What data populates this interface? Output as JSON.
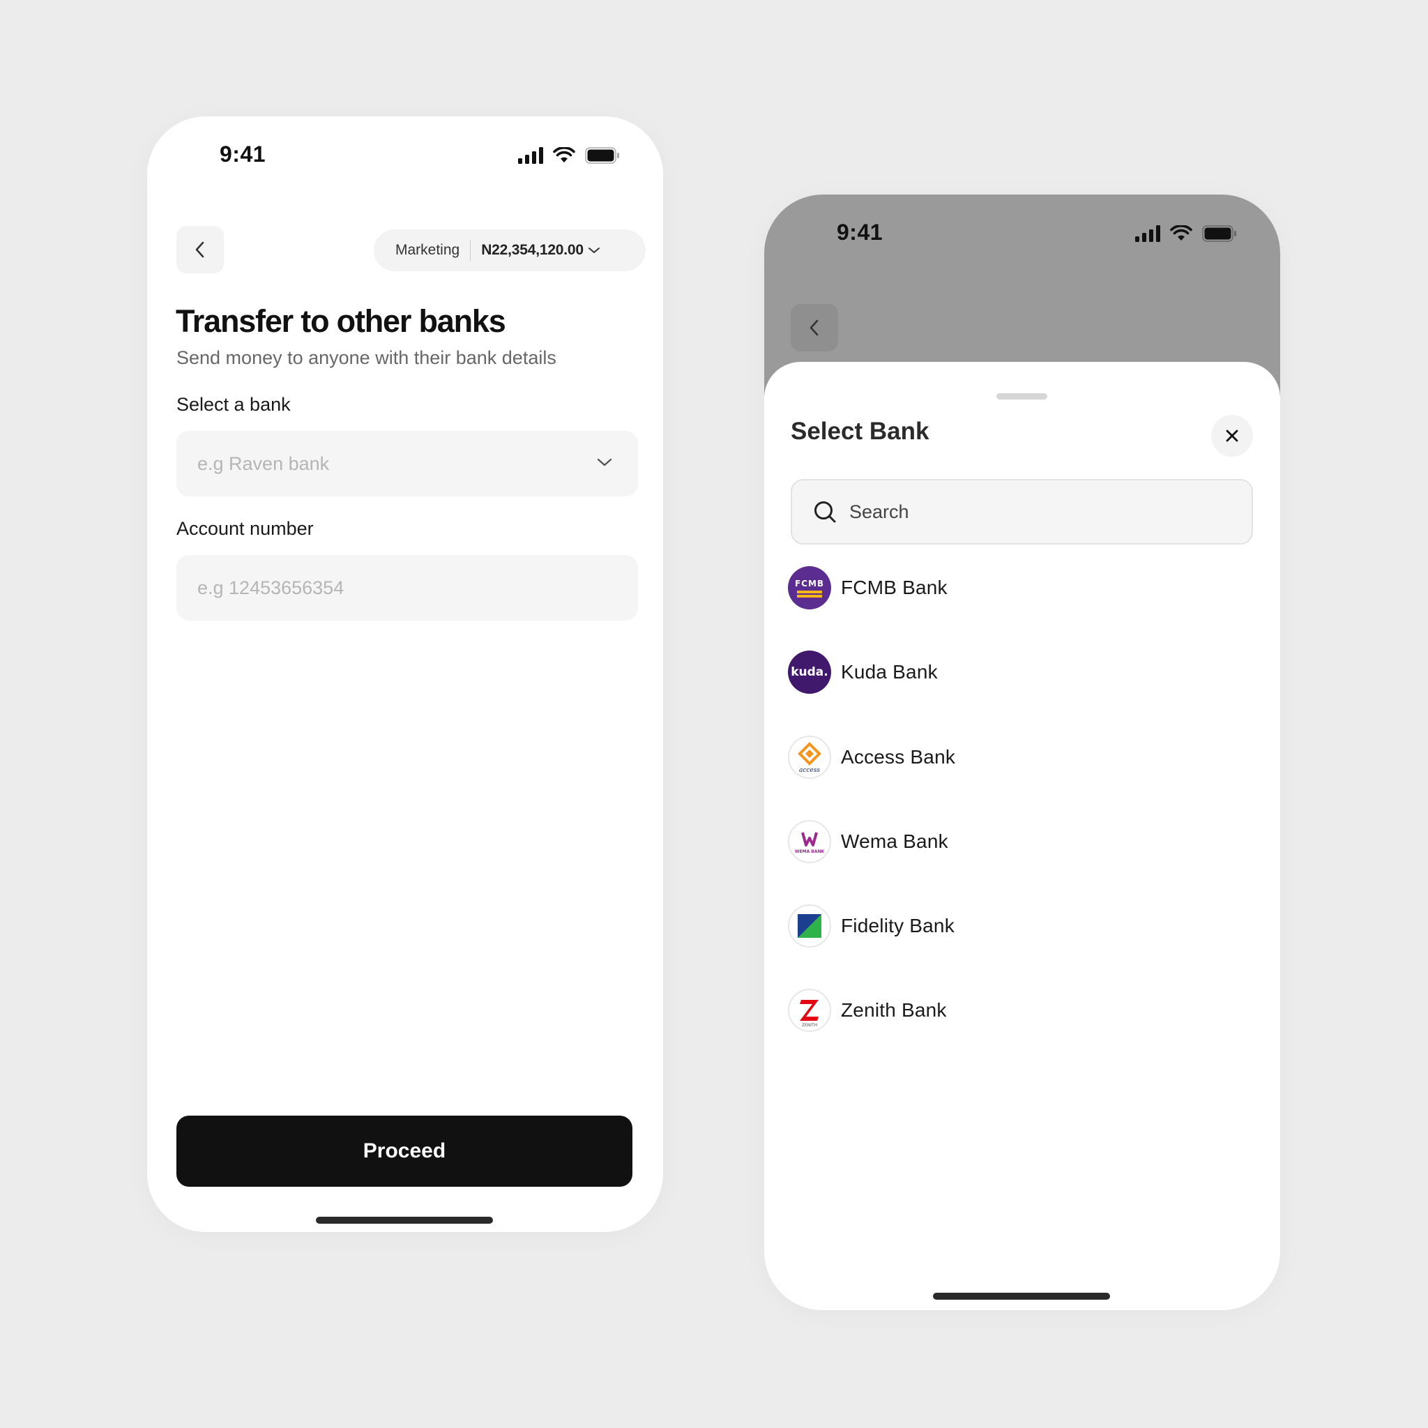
{
  "left_screen": {
    "status_time": "9:41",
    "account": {
      "name": "Marketing",
      "balance": "N22,354,120.00"
    },
    "title": "Transfer to other banks",
    "subtitle": "Send money to anyone with their bank details",
    "bank_label": "Select a bank",
    "bank_placeholder": "e.g Raven bank",
    "account_label": "Account number",
    "account_placeholder": "e.g 12453656354",
    "proceed_label": "Proceed"
  },
  "right_screen": {
    "status_time": "9:41",
    "sheet_title": "Select Bank",
    "search_placeholder": "Search",
    "banks": [
      {
        "name": "FCMB Bank",
        "logo_text": "FCMB",
        "color": "#5c2d91"
      },
      {
        "name": "Kuda Bank",
        "logo_text": "kuda.",
        "color": "#40196d"
      },
      {
        "name": "Access Bank",
        "logo_text": "access",
        "color": "#f7941d"
      },
      {
        "name": "Wema Bank",
        "logo_text": "WEMA BANK",
        "color": "#9c2a8e"
      },
      {
        "name": "Fidelity Bank",
        "logo_text": "",
        "color": "#1b3e8f"
      },
      {
        "name": "Zenith Bank",
        "logo_text": "ZENITH",
        "color": "#e30613"
      }
    ]
  },
  "colors": {
    "background": "#edecec",
    "primary_button": "#111111",
    "overlay": "#9a9a9a"
  }
}
